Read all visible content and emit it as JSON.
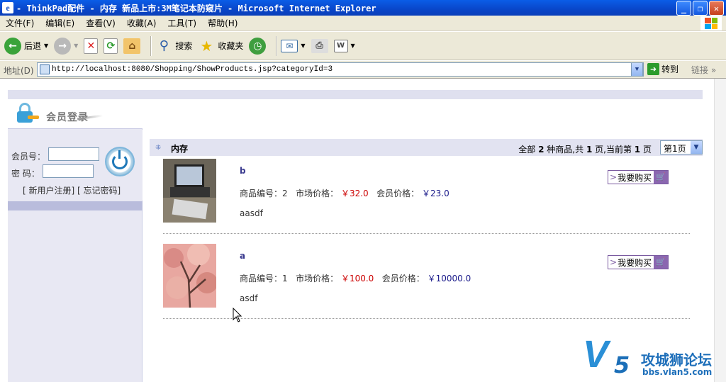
{
  "window": {
    "title": "- ThinkPad配件 - 内存 新品上市:3M笔记本防窥片 - Microsoft Internet Explorer"
  },
  "menu": {
    "items": [
      "文件(F)",
      "编辑(E)",
      "查看(V)",
      "收藏(A)",
      "工具(T)",
      "帮助(H)"
    ]
  },
  "toolbar": {
    "back_label": "后退",
    "search_label": "搜索",
    "favorites_label": "收藏夹"
  },
  "address": {
    "label": "地址(D)",
    "url": "http://localhost:8080/Shopping/ShowProducts.jsp?categoryId=3",
    "go_label": "转到",
    "links_label": "链接"
  },
  "login": {
    "title": "会员登录",
    "member_label": "会员号：",
    "password_label": "密 码：",
    "links_text": "[ 新用户注册] [ 忘记密码]"
  },
  "category": {
    "name": "内存",
    "summary_prefix": "全部",
    "total": "2",
    "summary_mid1": "种商品,共",
    "pages": "1",
    "summary_mid2": "页,当前第",
    "current": "1",
    "summary_suffix": "页",
    "page_select_value": "第1页"
  },
  "products": [
    {
      "name": "b",
      "code_label": "商品编号：",
      "code": "2",
      "market_label": "市场价格：",
      "market_price": "￥32.0",
      "member_label": "会员价格：",
      "member_price": "￥23.0",
      "desc": "aasdf",
      "buy_label": "我要购买"
    },
    {
      "name": "a",
      "code_label": "商品编号：",
      "code": "1",
      "market_label": "市场价格：",
      "market_price": "￥100.0",
      "member_label": "会员价格：",
      "member_price": "￥10000.0",
      "desc": "asdf",
      "buy_label": "我要购买"
    }
  ],
  "watermark": {
    "text": "攻城狮论坛",
    "url": "bbs.vlan5.com"
  }
}
